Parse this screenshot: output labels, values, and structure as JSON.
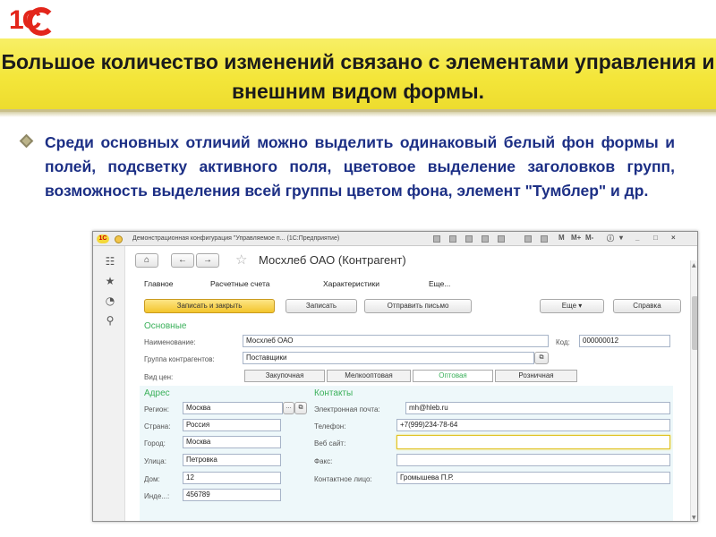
{
  "logo_text": "1С",
  "slide_title": "Большое количество изменений связано с элементами управления и внешним видом формы.",
  "bullet_text": "Среди основных отличий можно выделить одинаковый белый фон формы и полей, подсветку активного поля, цветовое выделение заголовков групп, возможность выделения всей группы цветом фона, элемент \"Тумблер\" и др.",
  "window": {
    "title": "Демонстрационная конфигурация \"Управляемое п... (1С:Предприятие)",
    "heading": "Мосхлеб ОАО (Контрагент)",
    "tabs": [
      "Главное",
      "Расчетные счета",
      "Характеристики",
      "Еще..."
    ],
    "buttons": {
      "save_close": "Записать и закрыть",
      "save": "Записать",
      "send_mail": "Отправить письмо",
      "more": "Еще",
      "help": "Справка"
    },
    "main_group": "Основные",
    "name_label": "Наименование:",
    "name_value": "Мосхлеб ОАО",
    "code_label": "Код:",
    "code_value": "000000012",
    "group_label": "Группа контрагентов:",
    "group_value": "Поставщики",
    "price_label": "Вид цен:",
    "price_options": [
      "Закупочная",
      "Мелкооптовая",
      "Оптовая",
      "Розничная"
    ],
    "price_selected": "Оптовая",
    "address_group": "Адрес",
    "contacts_group": "Контакты",
    "address": [
      {
        "label": "Регион:",
        "value": "Москва"
      },
      {
        "label": "Страна:",
        "value": "Россия"
      },
      {
        "label": "Город:",
        "value": "Москва"
      },
      {
        "label": "Улица:",
        "value": "Петровка"
      },
      {
        "label": "Дом:",
        "value": "12"
      },
      {
        "label": "Инде...:",
        "value": "456789"
      }
    ],
    "contacts": [
      {
        "label": "Электронная почта:",
        "value": "mh@hleb.ru"
      },
      {
        "label": "Телефон:",
        "value": "+7(999)234-78-64"
      },
      {
        "label": "Веб сайт:",
        "value": ""
      },
      {
        "label": "Факс:",
        "value": ""
      },
      {
        "label": "Контактное лицо:",
        "value": "Громышева П.Р."
      }
    ]
  }
}
